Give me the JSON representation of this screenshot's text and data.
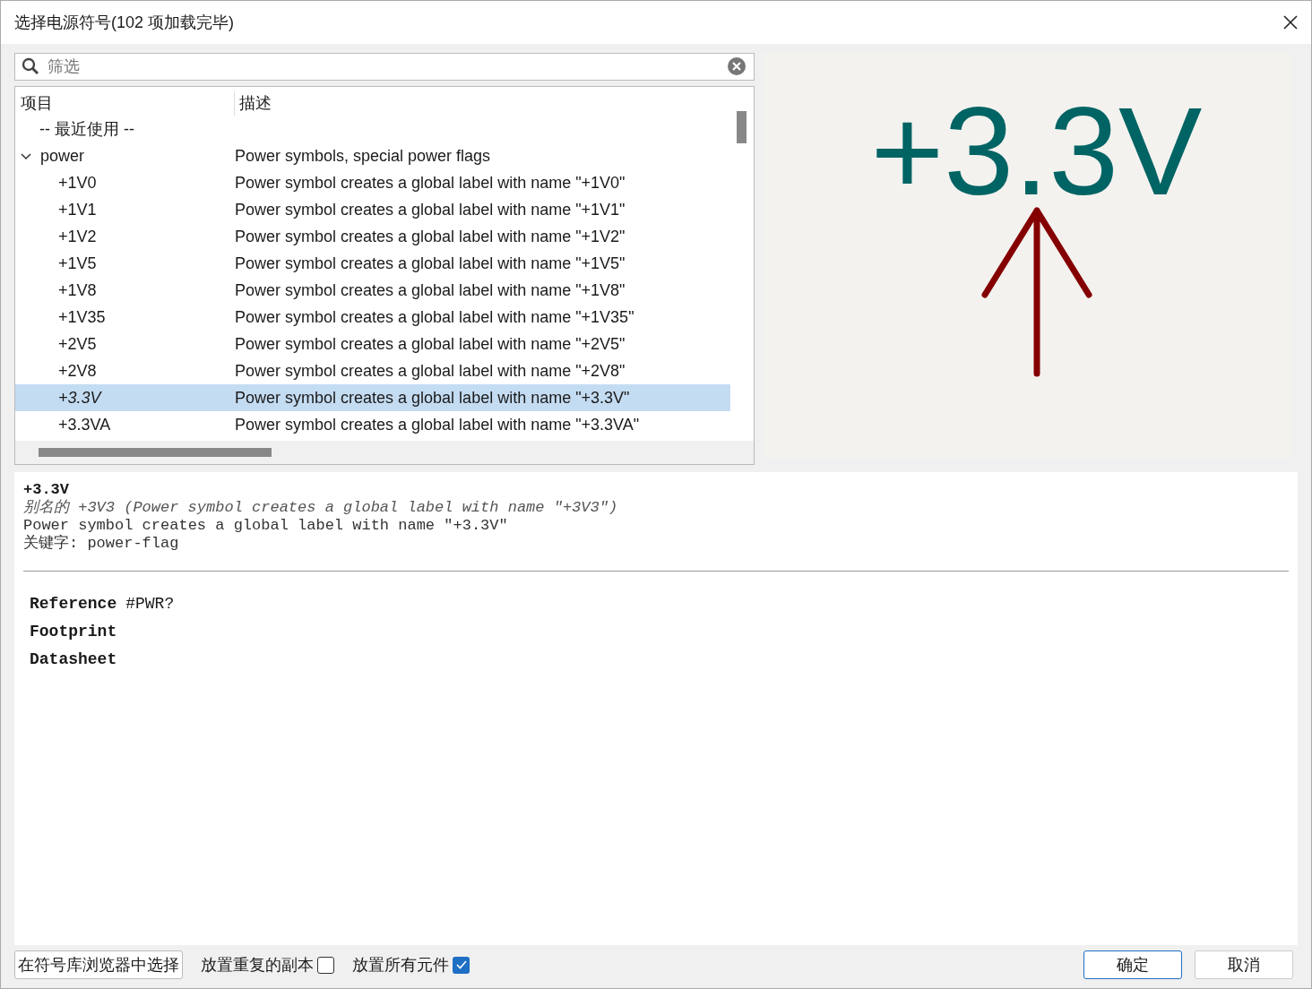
{
  "window": {
    "title": "选择电源符号(102 项加载完毕)"
  },
  "search": {
    "placeholder": "筛选"
  },
  "tree": {
    "columns": [
      "项目",
      "描述"
    ],
    "rows": [
      {
        "name": "-- 最近使用 --"
      },
      {
        "name": "power",
        "description": "Power symbols, special power flags",
        "expanded": true,
        "children": [
          {
            "name": "+1V0",
            "description": "Power symbol creates a global label with name \"+1V0\"",
            "selected": false
          },
          {
            "name": "+1V1",
            "description": "Power symbol creates a global label with name \"+1V1\"",
            "selected": false
          },
          {
            "name": "+1V2",
            "description": "Power symbol creates a global label with name \"+1V2\"",
            "selected": false
          },
          {
            "name": "+1V5",
            "description": "Power symbol creates a global label with name \"+1V5\"",
            "selected": false
          },
          {
            "name": "+1V8",
            "description": "Power symbol creates a global label with name \"+1V8\"",
            "selected": false
          },
          {
            "name": "+1V35",
            "description": "Power symbol creates a global label with name \"+1V35\"",
            "selected": false
          },
          {
            "name": "+2V5",
            "description": "Power symbol creates a global label with name \"+2V5\"",
            "selected": false
          },
          {
            "name": "+2V8",
            "description": "Power symbol creates a global label with name \"+2V8\"",
            "selected": false
          },
          {
            "name": "+3.3V",
            "description": "Power symbol creates a global label with name \"+3.3V\"",
            "selected": true
          },
          {
            "name": "+3.3VA",
            "description": "Power symbol creates a global label with name \"+3.3VA\"",
            "selected": false
          }
        ]
      }
    ]
  },
  "preview": {
    "text": "+3.3V"
  },
  "details": {
    "name": "+3.3V",
    "alias": "别名的 +3V3 (Power symbol creates a global label with name ″+3V3″)",
    "description": "Power symbol creates a global label with name ″+3.3V″",
    "keywords": "关键字: power-flag",
    "fields": [
      {
        "label": "Reference",
        "value": "#PWR?"
      },
      {
        "label": "Footprint"
      },
      {
        "label": "Datasheet"
      }
    ]
  },
  "footer": {
    "browse_button": "在符号库浏览器中选择",
    "checkboxes": [
      {
        "label": "放置重复的副本",
        "checked": false
      },
      {
        "label": "放置所有元件",
        "checked": true
      }
    ],
    "ok": "确定",
    "cancel": "取消"
  }
}
